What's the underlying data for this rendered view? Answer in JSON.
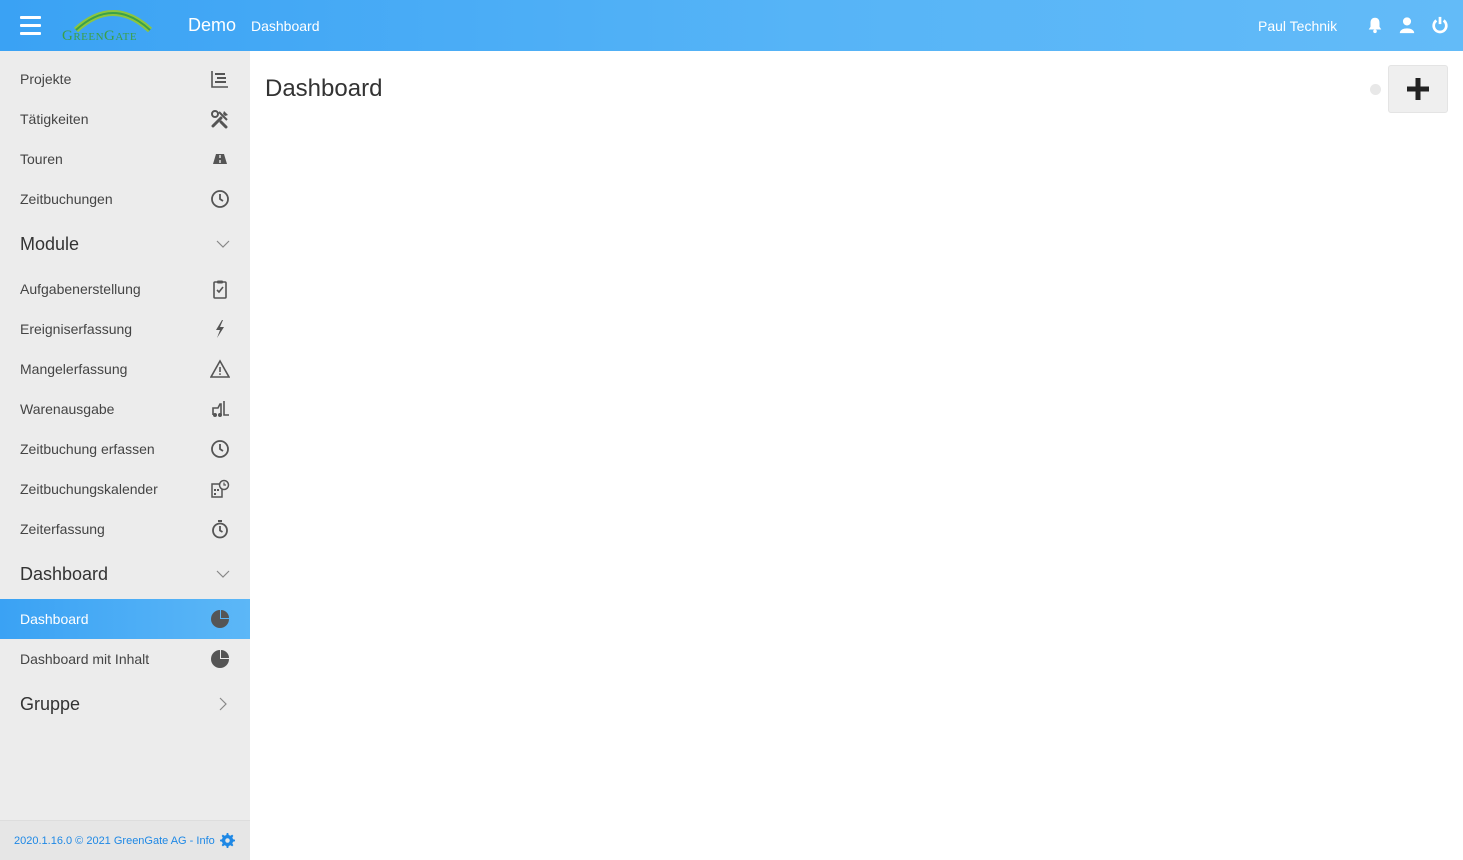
{
  "header": {
    "logo_text": "GreenGate",
    "app_title": "Demo",
    "breadcrumb": "Dashboard",
    "user_name": "Paul Technik",
    "icons": [
      "menu-icon",
      "bell-icon",
      "user-icon",
      "power-icon"
    ]
  },
  "sidebar": {
    "items": [
      {
        "label": "Projekte",
        "icon": "projects-icon"
      },
      {
        "label": "Tätigkeiten",
        "icon": "tools-icon"
      },
      {
        "label": "Touren",
        "icon": "road-icon"
      },
      {
        "label": "Zeitbuchungen",
        "icon": "clock-icon"
      }
    ],
    "groups": [
      {
        "label": "Module",
        "expanded": true,
        "items": [
          {
            "label": "Aufgabenerstellung",
            "icon": "clipboard-check-icon"
          },
          {
            "label": "Ereigniserfassung",
            "icon": "lightning-icon"
          },
          {
            "label": "Mangelerfassung",
            "icon": "warning-icon"
          },
          {
            "label": "Warenausgabe",
            "icon": "forklift-icon"
          },
          {
            "label": "Zeitbuchung erfassen",
            "icon": "clock-icon"
          },
          {
            "label": "Zeitbuchungskalender",
            "icon": "calendar-clock-icon"
          },
          {
            "label": "Zeiterfassung",
            "icon": "stopwatch-icon"
          }
        ]
      },
      {
        "label": "Dashboard",
        "expanded": true,
        "items": [
          {
            "label": "Dashboard",
            "icon": "pie-chart-icon",
            "active": true
          },
          {
            "label": "Dashboard mit Inhalt",
            "icon": "pie-chart-icon"
          }
        ]
      },
      {
        "label": "Gruppe",
        "expanded": false,
        "items": []
      }
    ],
    "footer": {
      "version_text": "2020.1.16.0 © 2021 GreenGate AG",
      "separator": " - ",
      "info_link": "Info"
    }
  },
  "main": {
    "title": "Dashboard",
    "add_button_icon": "plus-icon"
  },
  "colors": {
    "header_gradient_start": "#3aa2f4",
    "header_gradient_end": "#63bbf8",
    "active_item": "#3aa2f4",
    "sidebar_bg": "#ececec",
    "footer_link": "#1e88e5",
    "logo_green": "#3ba148"
  }
}
